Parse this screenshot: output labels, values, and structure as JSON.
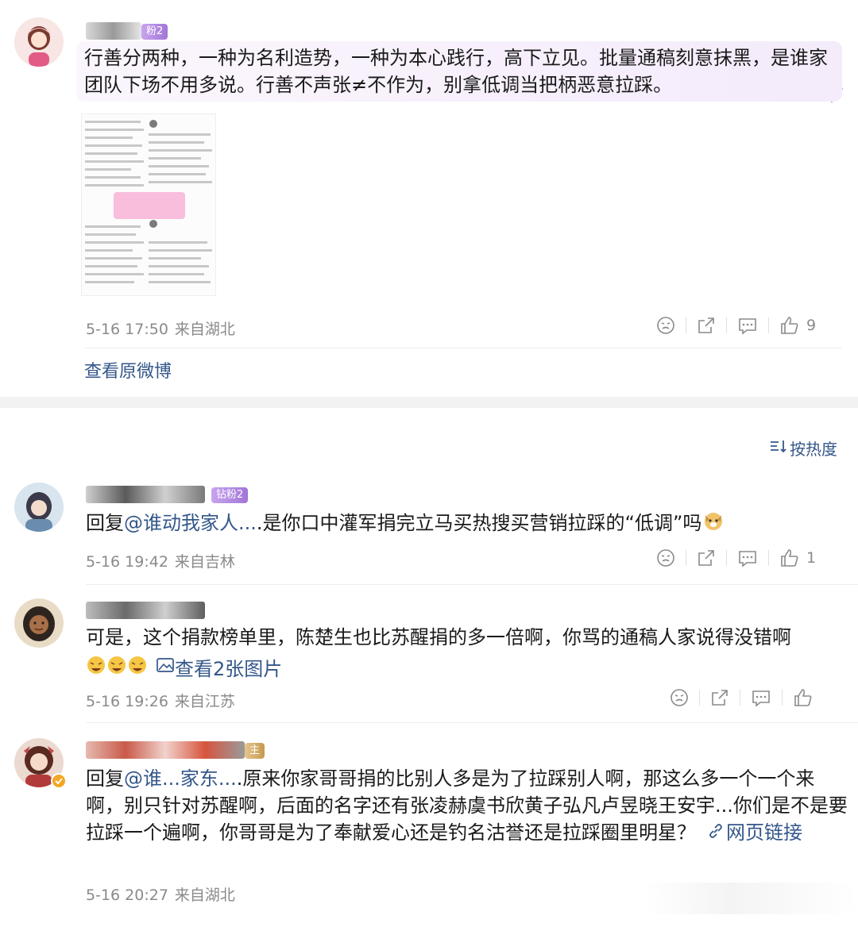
{
  "post": {
    "badge": "粉2",
    "text": "行善分两种，一种为名利造势，一种为本心践行，高下立见。批量通稿刻意抹黑，是谁家团队下场不用多说。行善不声张≠不作为，别拿低调当把柄恶意拉踩。",
    "time": "5-16 17:50",
    "location": "来自湖北",
    "like_count": "9",
    "view_original": "查看原微博"
  },
  "sort": {
    "label": "按热度"
  },
  "comments": [
    {
      "badge": "钻粉2",
      "reply_prefix": "回复",
      "mention": "@谁动我家人...",
      "text": ".是你口中灌军捐完立马买热搜买营销拉踩的“低调”吗",
      "time": "5-16 19:42",
      "location": "来自吉林",
      "like_count": "1"
    },
    {
      "text": "可是，这个捐款榜单里，陈楚生也比苏醒捐的多一倍啊，你骂的通稿人家说得没错啊",
      "image_link": "查看2张图片",
      "time": "5-16 19:26",
      "location": "来自江苏",
      "like_count": ""
    },
    {
      "badge": "主",
      "reply_prefix": "回复",
      "mention": "@谁...家东...",
      "text": ".原来你家哥哥捐的比别人多是为了拉踩别人啊，那这么多一个一个来啊，别只针对苏醒啊，后面的名字还有张凌赫虞书欣黄子弘凡卢昱晓王安宇...你们是不是要拉踩一个遍啊，你哥哥是为了奉献爱心还是钓名沽誉还是拉踩圈里明星？",
      "web_link": "网页链接",
      "time": "5-16 20:27",
      "location": "来自湖北"
    }
  ],
  "colors": {
    "link": "#34578a",
    "meta": "#8a8a8a",
    "badge": "#b085e0"
  }
}
